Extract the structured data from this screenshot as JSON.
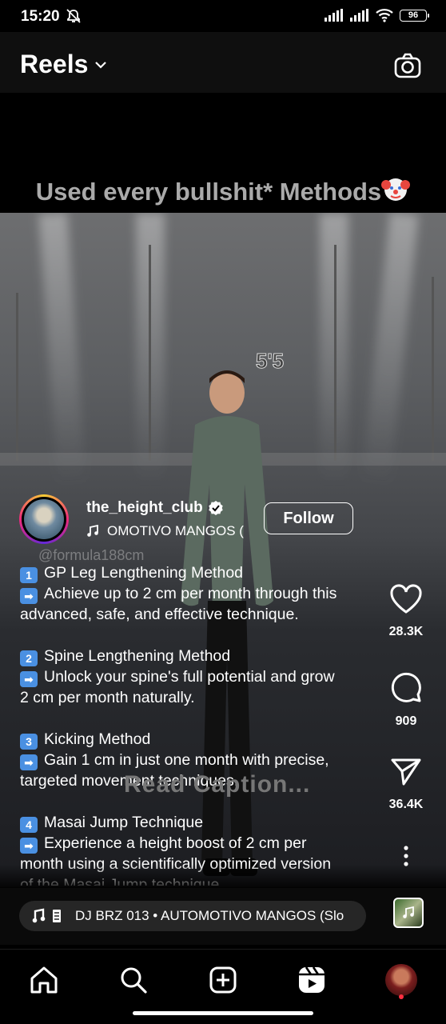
{
  "status_bar": {
    "time": "15:20",
    "battery": "96"
  },
  "header": {
    "title": "Reels"
  },
  "video": {
    "overlay_text": "Used every bullshit* Methods",
    "height_label": "5'5",
    "watermark": "@formula188cm",
    "read_caption_overlay": "Read Caption..."
  },
  "author": {
    "username": "the_height_club",
    "audio": "OMOTIVO MANGOS (",
    "follow_label": "Follow"
  },
  "caption": {
    "lines": [
      {
        "emoji": "1",
        "text": "GP Leg Lengthening Method"
      },
      {
        "emoji": "➡",
        "text": "Achieve up to 2 cm per month through this"
      },
      {
        "emoji": "",
        "text": "advanced, safe, and effective technique."
      },
      {
        "emoji": "",
        "text": ""
      },
      {
        "emoji": "2",
        "text": "Spine Lengthening Method"
      },
      {
        "emoji": "➡",
        "text": "Unlock your spine's full potential and grow"
      },
      {
        "emoji": "",
        "text": "2 cm per month naturally."
      },
      {
        "emoji": "",
        "text": ""
      },
      {
        "emoji": "3",
        "text": "Kicking Method"
      },
      {
        "emoji": "➡",
        "text": "Gain 1 cm in just one month with precise,"
      },
      {
        "emoji": "",
        "text": "targeted movement techniques."
      },
      {
        "emoji": "",
        "text": ""
      },
      {
        "emoji": "4",
        "text": "Masai Jump Technique"
      },
      {
        "emoji": "➡",
        "text": "Experience a height boost of 2 cm per"
      },
      {
        "emoji": "",
        "text": "month using a scientifically optimized version"
      },
      {
        "emoji": "",
        "text": "of the Masai Jump technique."
      }
    ]
  },
  "actions": {
    "likes": "28.3K",
    "comments": "909",
    "shares": "36.4K"
  },
  "music_bar": {
    "text": "DJ BRZ 013 • AUTOMOTIVO MANGOS (Slo"
  },
  "nav": {
    "icons": [
      "home-icon",
      "search-icon",
      "create-icon",
      "reels-icon",
      "profile-avatar"
    ]
  }
}
